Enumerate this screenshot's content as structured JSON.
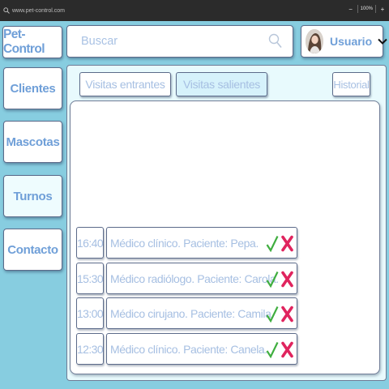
{
  "browser": {
    "url": "www.pet-control.com",
    "zoom": "100%",
    "zoom_out": "−",
    "zoom_in": "+"
  },
  "header": {
    "logo": "Pet-Control",
    "search": {
      "placeholder": "Buscar"
    },
    "user": {
      "name": "Usuario"
    }
  },
  "sidebar": {
    "items": [
      {
        "label": "Clientes"
      },
      {
        "label": "Mascotas"
      },
      {
        "label": "Turnos"
      },
      {
        "label": "Contacto"
      }
    ],
    "active": "Turnos"
  },
  "tabs": {
    "incoming": "Visitas entrantes",
    "outgoing": "Visitas salientes",
    "history": "Historial",
    "selected": "Visitas salientes"
  },
  "visits": [
    {
      "time": "16:40",
      "description": "Médico clínico. Paciente: Pepa."
    },
    {
      "time": "15:30",
      "description": "Médico radiólogo. Paciente: Carola."
    },
    {
      "time": "13:00",
      "description": "Médico cirujano. Paciente: Camila."
    },
    {
      "time": "12:30",
      "description": "Médico clínico. Paciente: Canela."
    }
  ],
  "colors": {
    "background": "#87cde0",
    "accent_text": "#6f9fd8",
    "muted_text": "#a6bfe2",
    "accept": "#3fae3f",
    "reject": "#e0245e"
  },
  "icons": {
    "search": "search-icon",
    "dropdown": "chevron-down-icon",
    "accept": "check-icon",
    "reject": "cross-icon"
  }
}
